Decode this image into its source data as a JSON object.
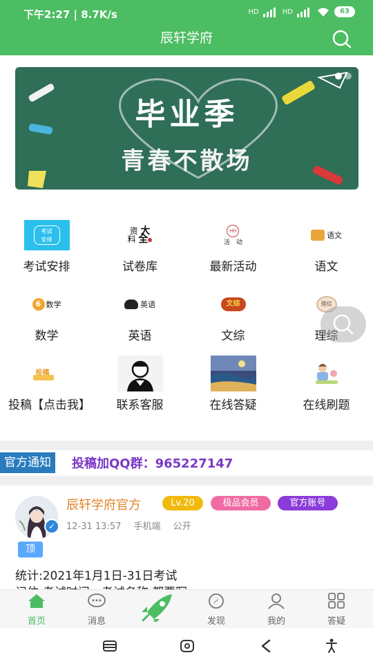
{
  "status": {
    "time": "下午2:27 | 8.7K/s",
    "battery": "63",
    "net1": "HD",
    "net2": "HD"
  },
  "header": {
    "title": "辰轩学府"
  },
  "banner": {
    "line1": "毕业季",
    "line2": "青春不散场"
  },
  "grid": [
    {
      "label": "考试安排",
      "icon": "exam-schedule-icon",
      "icon_text": "考试\n安排"
    },
    {
      "label": "试卷库",
      "icon": "paper-library-icon",
      "icon_text": "大全"
    },
    {
      "label": "最新活动",
      "icon": "activity-icon",
      "icon_text": "活动"
    },
    {
      "label": "语文",
      "icon": "chinese-icon",
      "icon_text": "语文"
    },
    {
      "label": "数学",
      "icon": "math-icon",
      "icon_text": "数学"
    },
    {
      "label": "英语",
      "icon": "english-icon",
      "icon_text": "英语"
    },
    {
      "label": "文综",
      "icon": "liberal-arts-icon",
      "icon_text": "文综"
    },
    {
      "label": "理综",
      "icon": "science-icon",
      "icon_text": "理综"
    },
    {
      "label": "投稿【点击我】",
      "icon": "submit-icon",
      "icon_text": "投稿"
    },
    {
      "label": "联系客服",
      "icon": "customer-service-icon",
      "icon_text": ""
    },
    {
      "label": "在线答疑",
      "icon": "online-qa-icon",
      "icon_text": ""
    },
    {
      "label": "在线刷题",
      "icon": "online-practice-icon",
      "icon_text": ""
    }
  ],
  "notice": {
    "tag": "官方通知",
    "text": "投稿加QQ群：965227147"
  },
  "post": {
    "author": "辰轩学府官方",
    "level": "Lv.20",
    "member": "极品会员",
    "official": "官方账号",
    "time": "12-31 13:57",
    "device": "手机端",
    "visibility": "公开",
    "pin": "顶",
    "line1": "统计:2021年1月1日-31日考试",
    "line2": "记住:考试时间、考试名称 都要写"
  },
  "nav": [
    {
      "label": "首页",
      "icon": "home-icon",
      "active": true
    },
    {
      "label": "消息",
      "icon": "message-icon",
      "active": false
    },
    {
      "label": "",
      "icon": "rocket-icon",
      "active": false
    },
    {
      "label": "发现",
      "icon": "compass-icon",
      "active": false
    },
    {
      "label": "我的",
      "icon": "user-icon",
      "active": false
    },
    {
      "label": "答疑",
      "icon": "grid-icon",
      "active": false
    }
  ],
  "colors": {
    "primary": "#4cbd62",
    "notice_tag": "#2a7bbd",
    "notice_text": "#7b39c5",
    "author": "#e0842a"
  }
}
